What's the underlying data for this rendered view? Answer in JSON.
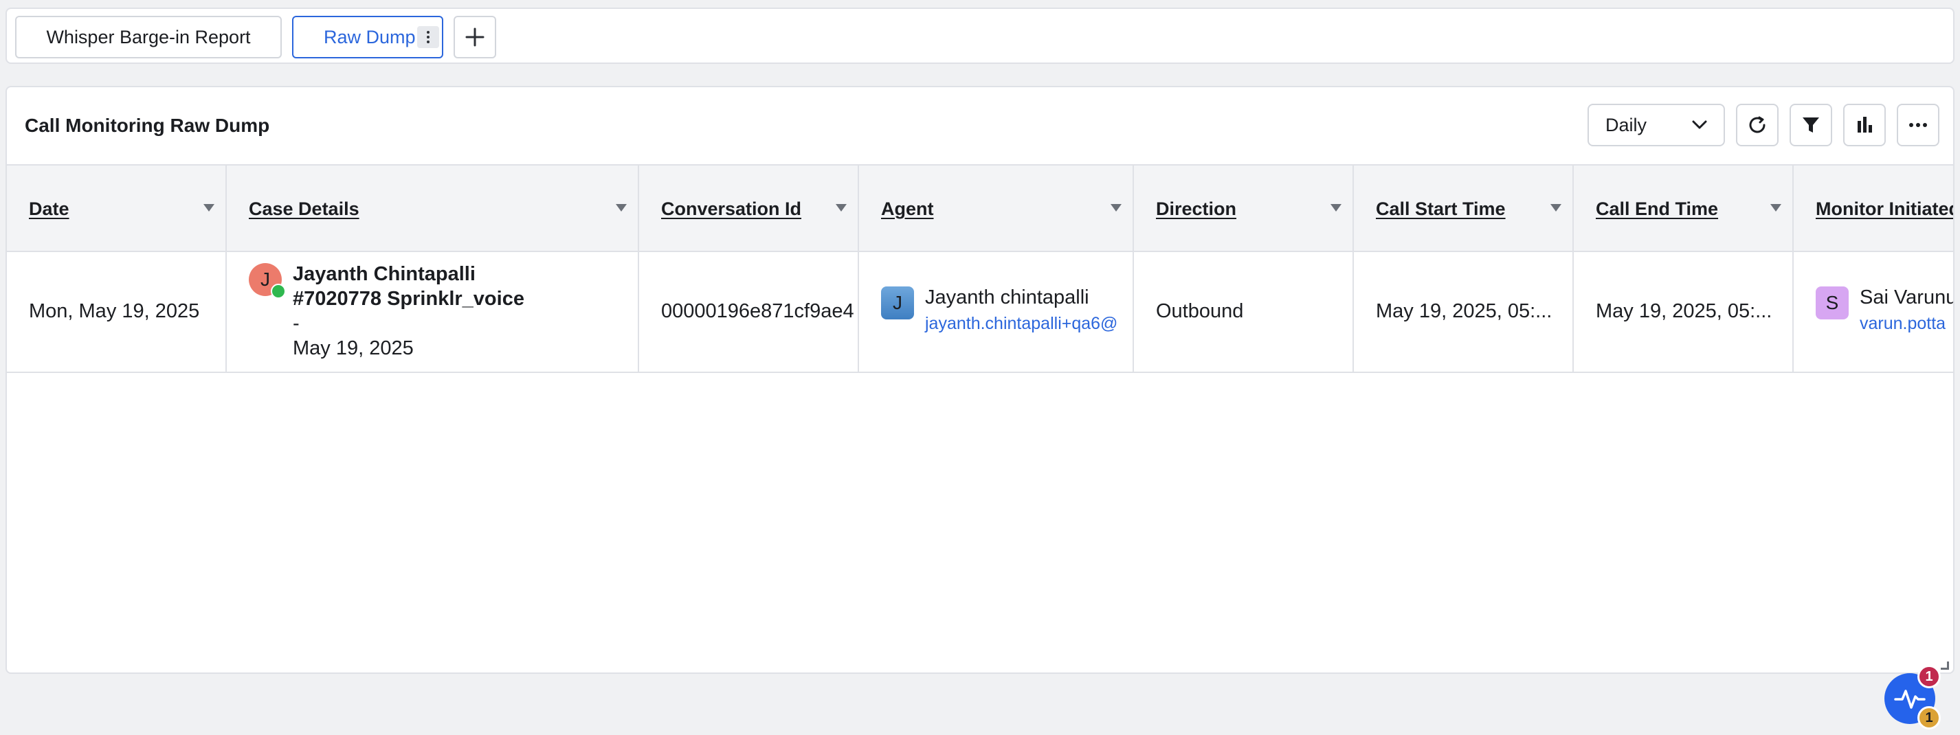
{
  "tabs": {
    "items": [
      {
        "label": "Whisper Barge-in Report"
      },
      {
        "label": "Raw Dump"
      }
    ],
    "add_icon": "plus-icon",
    "more_icon": "vertical-dots-icon"
  },
  "panel": {
    "title": "Call Monitoring Raw Dump",
    "period_select": {
      "value": "Daily"
    },
    "toolbar_icons": [
      "refresh-icon",
      "filter-icon",
      "bar-chart-icon",
      "more-horizontal-icon"
    ]
  },
  "table": {
    "columns": [
      {
        "label": "Date"
      },
      {
        "label": "Case Details"
      },
      {
        "label": "Conversation Id"
      },
      {
        "label": "Agent"
      },
      {
        "label": "Direction"
      },
      {
        "label": "Call Start Time"
      },
      {
        "label": "Call End Time"
      },
      {
        "label": "Monitor Initiated"
      }
    ],
    "rows": [
      {
        "date": "Mon, May 19, 2025",
        "case": {
          "avatar_letter": "J",
          "name": "Jayanth Chintapalli",
          "number_channel": "#7020778 Sprinklr_voice",
          "separator": "-",
          "date": "May 19, 2025"
        },
        "conversation_id": "00000196e871cf9ae4",
        "agent": {
          "avatar_letter": "J",
          "name": "Jayanth chintapalli",
          "email": "jayanth.chintapalli+qa6@"
        },
        "direction": "Outbound",
        "call_start": "May 19, 2025, 05:...",
        "call_end": "May 19, 2025, 05:...",
        "monitor": {
          "avatar_letter": "S",
          "name": "Sai Varunu",
          "email": "varun.potta"
        }
      }
    ]
  },
  "widget": {
    "icon": "activity-pulse-icon",
    "badge_red": "1",
    "badge_yellow": "1"
  },
  "colors": {
    "accent": "#2b66dc",
    "badge_red": "#c1294e",
    "badge_yellow": "#dba236",
    "case_avatar": "#ec7b6b",
    "monitor_avatar": "#d7a6f2"
  }
}
